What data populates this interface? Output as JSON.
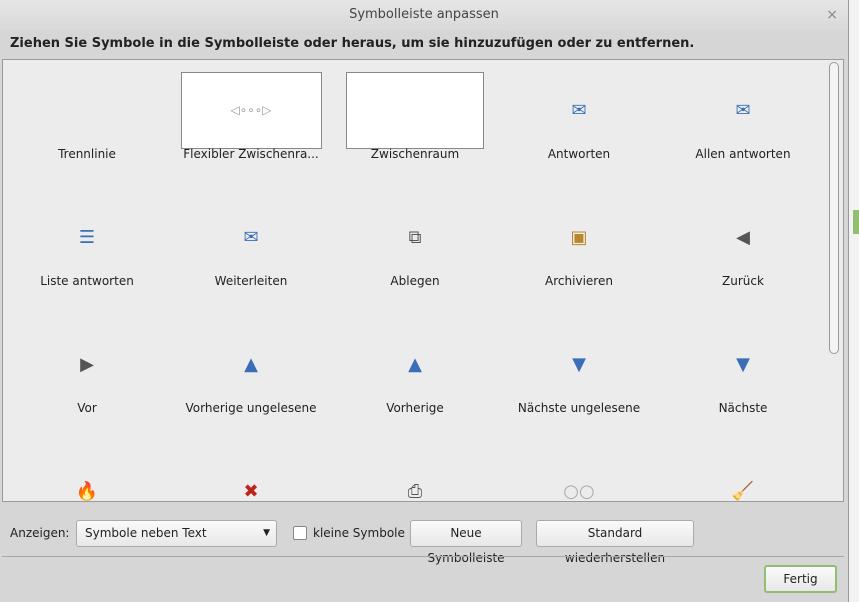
{
  "title": "Symbolleiste anpassen",
  "close": "×",
  "instruction": "Ziehen Sie Symbole in die Symbolleiste oder heraus, um sie hinzuzufügen oder zu entfernen.",
  "items": [
    {
      "label": "Trennlinie",
      "icon": ""
    },
    {
      "label": "Flexibler Zwischenra...",
      "icon": "◁∘∘∘▷"
    },
    {
      "label": "Zwischenraum",
      "icon": ""
    },
    {
      "label": "Antworten",
      "icon": "✉"
    },
    {
      "label": "Allen antworten",
      "icon": "✉"
    },
    {
      "label": "Liste antworten",
      "icon": "☰"
    },
    {
      "label": "Weiterleiten",
      "icon": "✉"
    },
    {
      "label": "Ablegen",
      "icon": "⧉"
    },
    {
      "label": "Archivieren",
      "icon": "▣"
    },
    {
      "label": "Zurück",
      "icon": "◀"
    },
    {
      "label": "Vor",
      "icon": "▶"
    },
    {
      "label": "Vorherige ungelesene",
      "icon": "▲"
    },
    {
      "label": "Vorherige",
      "icon": "▲"
    },
    {
      "label": "Nächste ungelesene",
      "icon": "▼"
    },
    {
      "label": "Nächste",
      "icon": "▼"
    },
    {
      "label": "",
      "icon": "🔥"
    },
    {
      "label": "",
      "icon": "✖"
    },
    {
      "label": "",
      "icon": "⎙"
    },
    {
      "label": "",
      "icon": "○○"
    },
    {
      "label": "",
      "icon": "🧹"
    }
  ],
  "bottom": {
    "show_label": "Anzeigen:",
    "show_value": "Symbole neben Text",
    "small_icons": "kleine Symbole",
    "new_toolbar": "Neue Symbolleiste",
    "restore": "Standard wiederherstellen",
    "done": "Fertig"
  },
  "colors": {
    "accent": "#3a6fb8",
    "done_border": "#8fbf6f"
  }
}
